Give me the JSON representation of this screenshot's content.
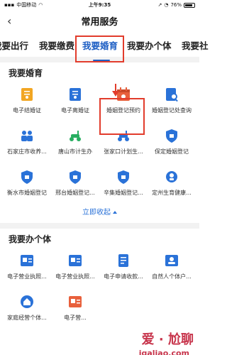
{
  "status": {
    "carrier": "中国移动",
    "time": "上午9:35",
    "battery": "76%",
    "battery_level": 0.76
  },
  "nav": {
    "title": "常用服务",
    "back_icon": "back-chevron-icon"
  },
  "tabs": [
    {
      "label": "我要出行",
      "active": false
    },
    {
      "label": "我要缴费",
      "active": false
    },
    {
      "label": "我要婚育",
      "active": true
    },
    {
      "label": "我要办个体",
      "active": false
    },
    {
      "label": "我要社",
      "active": false
    }
  ],
  "sections": [
    {
      "title": "我要婚育",
      "items": [
        {
          "label": "电子结婚证",
          "icon": "certificate-icon",
          "color": "#f2a623"
        },
        {
          "label": "电子离婚证",
          "icon": "certificate-icon",
          "color": "#2a72d8"
        },
        {
          "label": "婚姻登记预约",
          "icon": "calendar-icon",
          "color": "#e8603c"
        },
        {
          "label": "婚姻登记处查询",
          "icon": "search-doc-icon",
          "color": "#2a72d8"
        },
        {
          "label": "石家庄市收养...",
          "icon": "family-icon",
          "color": "#2a72d8"
        },
        {
          "label": "唐山市计生办",
          "icon": "scooter-icon",
          "color": "#27ae60"
        },
        {
          "label": "张家口计划生...",
          "icon": "scooter-icon",
          "color": "#2a72d8"
        },
        {
          "label": "保定婚姻登记",
          "icon": "shield-icon",
          "color": "#2a72d8"
        },
        {
          "label": "衡水市婚姻登记",
          "icon": "shield-icon",
          "color": "#2a72d8"
        },
        {
          "label": "邢台婚姻登记...",
          "icon": "shield-icon",
          "color": "#2a72d8"
        },
        {
          "label": "辛集婚姻登记...",
          "icon": "shield-icon",
          "color": "#2a72d8"
        },
        {
          "label": "定州生育健康...",
          "icon": "baby-icon",
          "color": "#2a72d8"
        }
      ]
    },
    {
      "title": "我要办个体",
      "items": [
        {
          "label": "电子营业执照...",
          "icon": "license-icon",
          "color": "#2a72d8"
        },
        {
          "label": "电子营业执照...",
          "icon": "license-icon",
          "color": "#2a72d8"
        },
        {
          "label": "电子申请收款...",
          "icon": "bill-icon",
          "color": "#2a72d8"
        },
        {
          "label": "自然人个体户...",
          "icon": "person-card-icon",
          "color": "#2a72d8"
        },
        {
          "label": "家庭经营个体...",
          "icon": "home-icon",
          "color": "#2a72d8"
        },
        {
          "label": "电子营...",
          "icon": "license-icon",
          "color": "#e8603c"
        }
      ]
    }
  ],
  "expand": {
    "label": "立即收起"
  },
  "watermark": {
    "text": "爱 · 尬聊",
    "sub": "igaliao.com"
  }
}
